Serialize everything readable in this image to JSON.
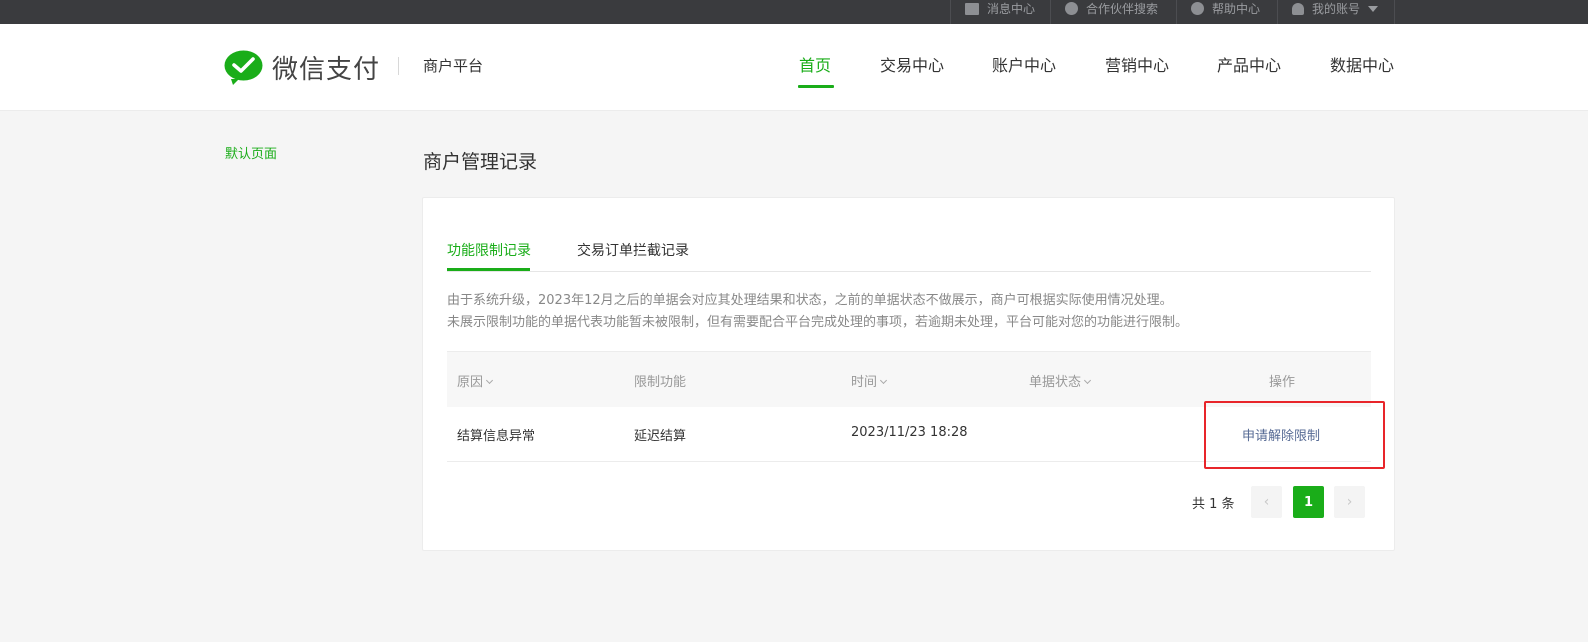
{
  "topbar": {
    "items": [
      {
        "label": "消息中心",
        "icon": "mail-icon"
      },
      {
        "label": "合作伙伴搜索",
        "icon": "partner-icon"
      },
      {
        "label": "帮助中心",
        "icon": "help-icon"
      },
      {
        "label": "我的账号",
        "icon": "user-icon"
      }
    ]
  },
  "header": {
    "brand": "微信支付",
    "subtitle": "商户平台",
    "nav": [
      "首页",
      "交易中心",
      "账户中心",
      "营销中心",
      "产品中心",
      "数据中心"
    ],
    "active_nav": "首页",
    "brand_color": "#1aad19"
  },
  "sidebar": {
    "items": [
      {
        "label": "默认页面"
      }
    ]
  },
  "main": {
    "title": "商户管理记录",
    "tabs": [
      {
        "label": "功能限制记录",
        "active": true
      },
      {
        "label": "交易订单拦截记录",
        "active": false
      }
    ],
    "notice": [
      "由于系统升级，2023年12月之后的单据会对应其处理结果和状态，之前的单据状态不做展示，商户可根据实际使用情况处理。",
      "未展示限制功能的单据代表功能暂未被限制，但有需要配合平台完成处理的事项，若逾期未处理，平台可能对您的功能进行限制。"
    ],
    "table": {
      "headers": [
        "原因",
        "限制功能",
        "时间",
        "单据状态",
        "操作"
      ],
      "rows": [
        {
          "reason": "结算信息异常",
          "function": "延迟结算",
          "time": "2023/11/23 18:28",
          "status": "",
          "action": "申请解除限制"
        }
      ]
    },
    "pagination": {
      "total": "共 1 条",
      "current_page": "1",
      "prev": "‹",
      "next": "›"
    }
  },
  "colors": {
    "accent": "#1aad19",
    "link": "#576b95",
    "highlight": "#e8252a"
  }
}
